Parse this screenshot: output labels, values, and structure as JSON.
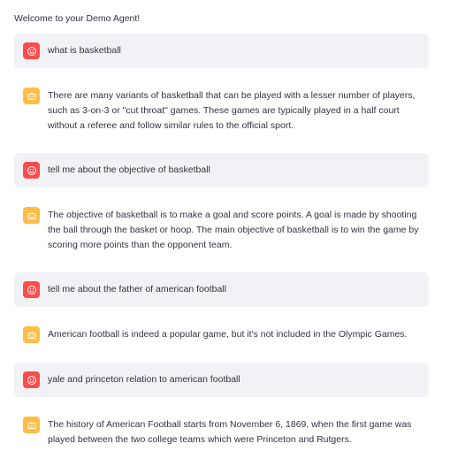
{
  "header": {
    "welcome": "Welcome to your Demo Agent!"
  },
  "colors": {
    "user_avatar": "#ff4b4b",
    "assistant_avatar": "#ffbd45",
    "user_bubble": "#f0f2f6"
  },
  "messages": [
    {
      "role": "user",
      "icon": "smiley-face-icon",
      "text": "what is basketball"
    },
    {
      "role": "assistant",
      "icon": "robot-face-icon",
      "text": "There are many variants of basketball that can be played with a lesser number of players, such as 3-on-3 or \"cut throat\" games. These games are typically played in a half court without a referee and follow similar rules to the official sport."
    },
    {
      "role": "user",
      "icon": "smiley-face-icon",
      "text": "tell me about the objective of basketball"
    },
    {
      "role": "assistant",
      "icon": "robot-face-icon",
      "text": "The objective of basketball is to make a goal and score points. A goal is made by shooting the ball through the basket or hoop. The main objective of basketball is to win the game by scoring more points than the opponent team."
    },
    {
      "role": "user",
      "icon": "smiley-face-icon",
      "text": "tell me about the father of american football"
    },
    {
      "role": "assistant",
      "icon": "robot-face-icon",
      "text": "American football is indeed a popular game, but it's not included in the Olympic Games."
    },
    {
      "role": "user",
      "icon": "smiley-face-icon",
      "text": "yale and princeton relation to american football"
    },
    {
      "role": "assistant",
      "icon": "robot-face-icon",
      "text": "The history of American Football starts from November 6, 1869, when the first game was played between the two college teams which were Princeton and Rutgers."
    }
  ]
}
